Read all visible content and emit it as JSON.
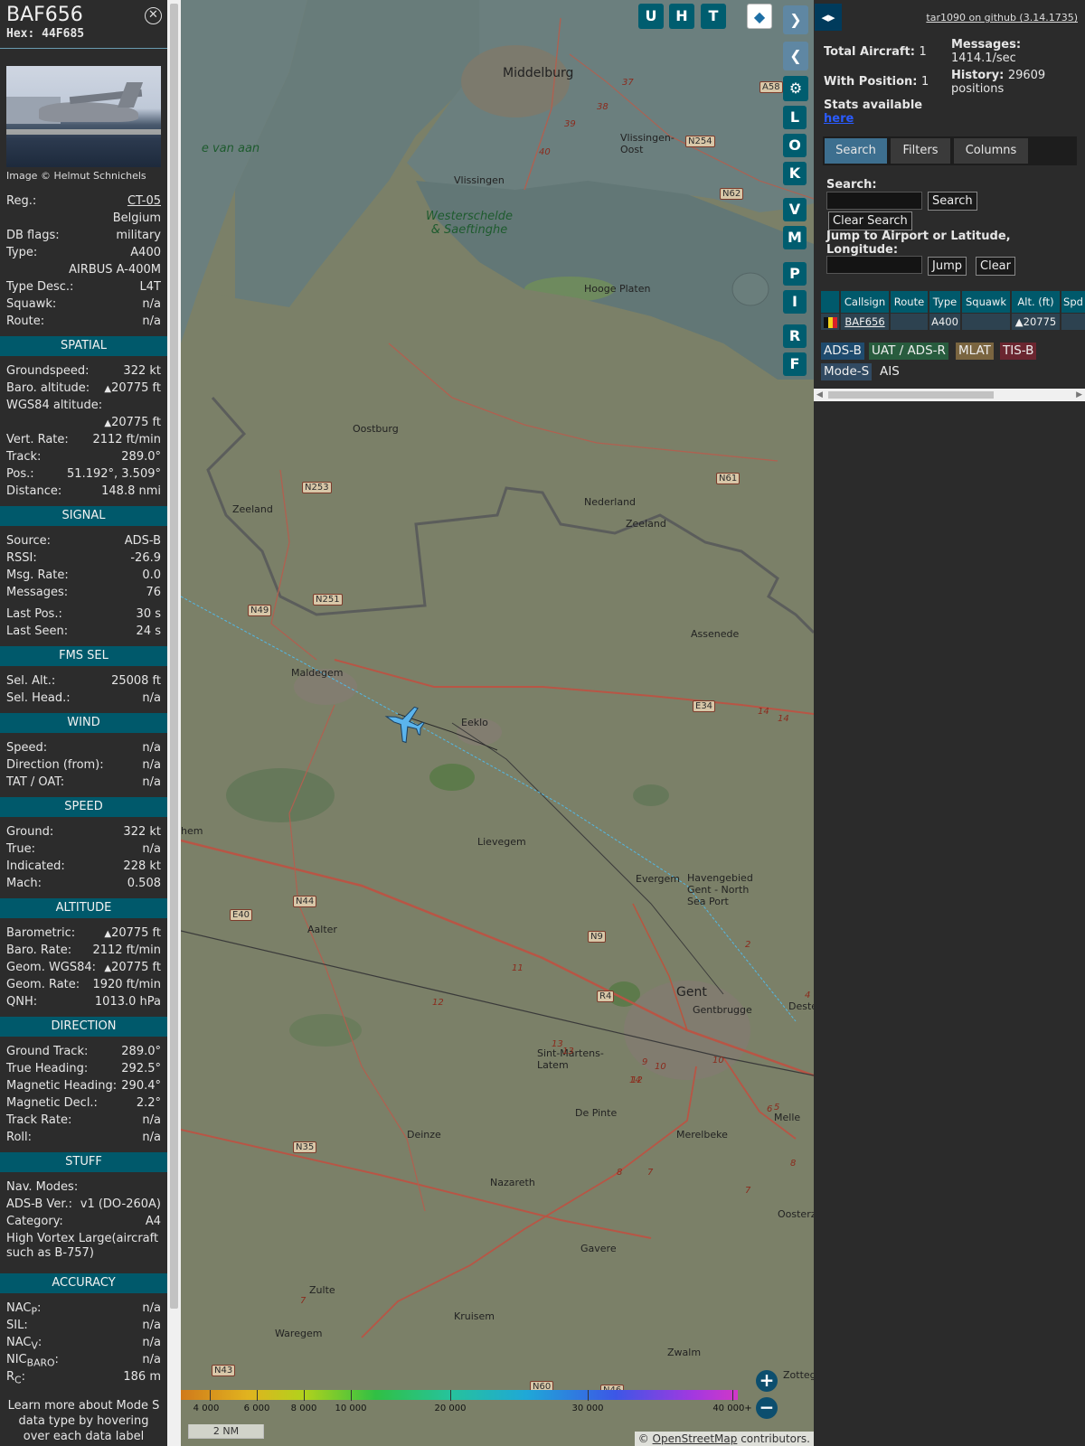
{
  "selected": {
    "callsign": "BAF656",
    "hex": "Hex: 44F685",
    "photo_credit": "Image © Helmut Schnichels"
  },
  "info": [
    {
      "k": "Reg.:",
      "v": "CT-05",
      "link": true
    },
    {
      "k": "",
      "v": "Belgium"
    },
    {
      "k": "DB flags:",
      "v": "military"
    },
    {
      "k": "Type:",
      "v": "A400"
    },
    {
      "k": "",
      "v": "AIRBUS A-400M"
    },
    {
      "k": "Type Desc.:",
      "v": "L4T"
    },
    {
      "k": "Squawk:",
      "v": "n/a"
    },
    {
      "k": "Route:",
      "v": "n/a"
    }
  ],
  "sections": {
    "spatial": "SPATIAL",
    "signal": "SIGNAL",
    "fms": "FMS SEL",
    "wind": "WIND",
    "speed": "SPEED",
    "altitude": "ALTITUDE",
    "direction": "DIRECTION",
    "stuff": "STUFF",
    "accuracy": "ACCURACY"
  },
  "spatial": {
    "groundspeed_k": "Groundspeed:",
    "groundspeed": "322 kt",
    "baro_k": "Baro. altitude:",
    "baro": "20775 ft",
    "wgs_k": "WGS84 altitude:",
    "wgs": "20775 ft",
    "vrate_k": "Vert. Rate:",
    "vrate": "2112 ft/min",
    "track_k": "Track:",
    "track": "289.0°",
    "pos_k": "Pos.:",
    "pos": "51.192°, 3.509°",
    "dist_k": "Distance:",
    "dist": "148.8 nmi"
  },
  "signal": [
    {
      "k": "Source:",
      "v": "ADS-B"
    },
    {
      "k": "RSSI:",
      "v": "-26.9"
    },
    {
      "k": "Msg. Rate:",
      "v": "0.0"
    },
    {
      "k": "Messages:",
      "v": "76"
    },
    {
      "k": "Last Pos.:",
      "v": "30 s"
    },
    {
      "k": "Last Seen:",
      "v": "24 s"
    }
  ],
  "fms": [
    {
      "k": "Sel. Alt.:",
      "v": "25008 ft"
    },
    {
      "k": "Sel. Head.:",
      "v": "n/a"
    }
  ],
  "wind": [
    {
      "k": "Speed:",
      "v": "n/a"
    },
    {
      "k": "Direction (from):",
      "v": "n/a"
    },
    {
      "k": "TAT / OAT:",
      "v": "n/a"
    }
  ],
  "speed": [
    {
      "k": "Ground:",
      "v": "322 kt"
    },
    {
      "k": "True:",
      "v": "n/a"
    },
    {
      "k": "Indicated:",
      "v": "228 kt"
    },
    {
      "k": "Mach:",
      "v": "0.508"
    }
  ],
  "altitude": [
    {
      "k": "Barometric:",
      "v": "20775 ft",
      "tri": true
    },
    {
      "k": "Baro. Rate:",
      "v": "2112 ft/min"
    },
    {
      "k": "Geom. WGS84:",
      "v": "20775 ft",
      "tri": true
    },
    {
      "k": "Geom. Rate:",
      "v": "1920 ft/min"
    },
    {
      "k": "QNH:",
      "v": "1013.0 hPa"
    }
  ],
  "direction": [
    {
      "k": "Ground Track:",
      "v": "289.0°"
    },
    {
      "k": "True Heading:",
      "v": "292.5°"
    },
    {
      "k": "Magnetic Heading:",
      "v": "290.4°"
    },
    {
      "k": "Magnetic Decl.:",
      "v": "2.2°"
    },
    {
      "k": "Track Rate:",
      "v": "n/a"
    },
    {
      "k": "Roll:",
      "v": "n/a"
    }
  ],
  "stuff": {
    "nav_k": "Nav. Modes:",
    "adsb_k": "ADS-B Ver.:",
    "adsb": "v1 (DO-260A)",
    "cat_k": "Category:",
    "cat": "A4",
    "cat_desc": "High Vortex Large(aircraft such as B-757)"
  },
  "accuracy": [
    {
      "k": "NAC",
      "sub": "P",
      "v": "n/a"
    },
    {
      "k": "SIL:",
      "sub": "",
      "v": "n/a"
    },
    {
      "k": "NAC",
      "sub": "V",
      "v": "n/a"
    },
    {
      "k": "NIC",
      "sub": "BARO",
      "v": "n/a"
    },
    {
      "k": "R",
      "sub": "C",
      "v": "186 m"
    }
  ],
  "learn_more": "Learn more about Mode S data type by hovering over each data label",
  "map": {
    "buttons_top": [
      "U",
      "H",
      "T"
    ],
    "side_buttons": [
      "L",
      "O",
      "K",
      "V",
      "M",
      "P",
      "I",
      "R",
      "F"
    ],
    "places": [
      {
        "name": "Middelburg",
        "big": true
      },
      {
        "name": "Vlissingen"
      },
      {
        "name": "Vlissingen-Oost"
      },
      {
        "name": "Westerschelde & Saeftinghe",
        "water": true
      },
      {
        "name": "Hooge Platen"
      },
      {
        "name": "e van aan",
        "water": true
      },
      {
        "name": "Oostburg"
      },
      {
        "name": "Nederland"
      },
      {
        "name": "Zeeland"
      },
      {
        "name": "Zeeland"
      },
      {
        "name": "Assenede"
      },
      {
        "name": "Maldegem"
      },
      {
        "name": "Eeklo"
      },
      {
        "name": "Lievegem"
      },
      {
        "name": "Evergem"
      },
      {
        "name": "Havengebied Gent - North Sea Port"
      },
      {
        "name": "Aalter"
      },
      {
        "name": "Gent",
        "big": true
      },
      {
        "name": "Gentbrugge"
      },
      {
        "name": "Destelberge"
      },
      {
        "name": "Sint-Martens-Latem"
      },
      {
        "name": "De Pinte"
      },
      {
        "name": "Merelbeke"
      },
      {
        "name": "Melle"
      },
      {
        "name": "Deinze"
      },
      {
        "name": "Nazareth"
      },
      {
        "name": "Oosterze"
      },
      {
        "name": "Gavere"
      },
      {
        "name": "Zulte"
      },
      {
        "name": "Kruisem"
      },
      {
        "name": "Waregem"
      },
      {
        "name": "Zwalm"
      },
      {
        "name": "Zottege"
      },
      {
        "name": "hem"
      }
    ],
    "roads": [
      "A58",
      "N254",
      "N62",
      "N253",
      "N61",
      "N251",
      "N49",
      "E34",
      "N44",
      "E40",
      "N9",
      "R4",
      "N35",
      "N43",
      "N60",
      "N46"
    ],
    "road_numbers": [
      "37",
      "38",
      "39",
      "40",
      "14",
      "14",
      "12",
      "13",
      "13",
      "11",
      "9",
      "10",
      "14",
      "12",
      "2",
      "7",
      "8",
      "8",
      "7",
      "6",
      "5",
      "4",
      "7",
      "10"
    ],
    "legend_labels": [
      "4 000",
      "6 000",
      "8 000",
      "10 000",
      "20 000",
      "30 000",
      "40 000+"
    ],
    "scale": "2 NM",
    "attribution_prefix": "© ",
    "attribution_link": "OpenStreetMap",
    "attribution_suffix": " contributors.",
    "zoom_in": "+",
    "zoom_out": "−"
  },
  "right": {
    "collapse": "◂▸",
    "version": "tar1090 on github (3.14.1735)",
    "total_k": "Total Aircraft:",
    "total": "1",
    "withpos_k": "With Position:",
    "withpos": "1",
    "stats_avail": "Stats available",
    "here": "here",
    "messages_k": "Messages:",
    "messages": "1414.1/sec",
    "history_k": "History:",
    "history": "29609 positions",
    "tabs": [
      "Search",
      "Filters",
      "Columns"
    ],
    "search_lbl": "Search:",
    "search_btn": "Search",
    "clear_search": "Clear Search",
    "jump_lbl": "Jump to Airport or Latitude, Longitude:",
    "jump_btn": "Jump",
    "clear_btn": "Clear",
    "table_headers": [
      "Callsign",
      "Route",
      "Type",
      "Squawk",
      "Alt. (ft)",
      "Spd"
    ],
    "row": {
      "callsign": "BAF656",
      "route": "",
      "type": "A400",
      "squawk": "",
      "alt": "▲20775",
      "spd": ""
    },
    "chips": [
      "ADS-B",
      "UAT / ADS-R",
      "MLAT",
      "TIS-B",
      "Mode-S",
      "AIS"
    ]
  },
  "colors": {
    "section_bg": "#00596b",
    "accent": "#005d6f",
    "adsb": "#1f4b6e",
    "uat": "#285c3e",
    "mlat": "#7a6540",
    "tisb": "#6b2630",
    "modes": "#314a62"
  }
}
